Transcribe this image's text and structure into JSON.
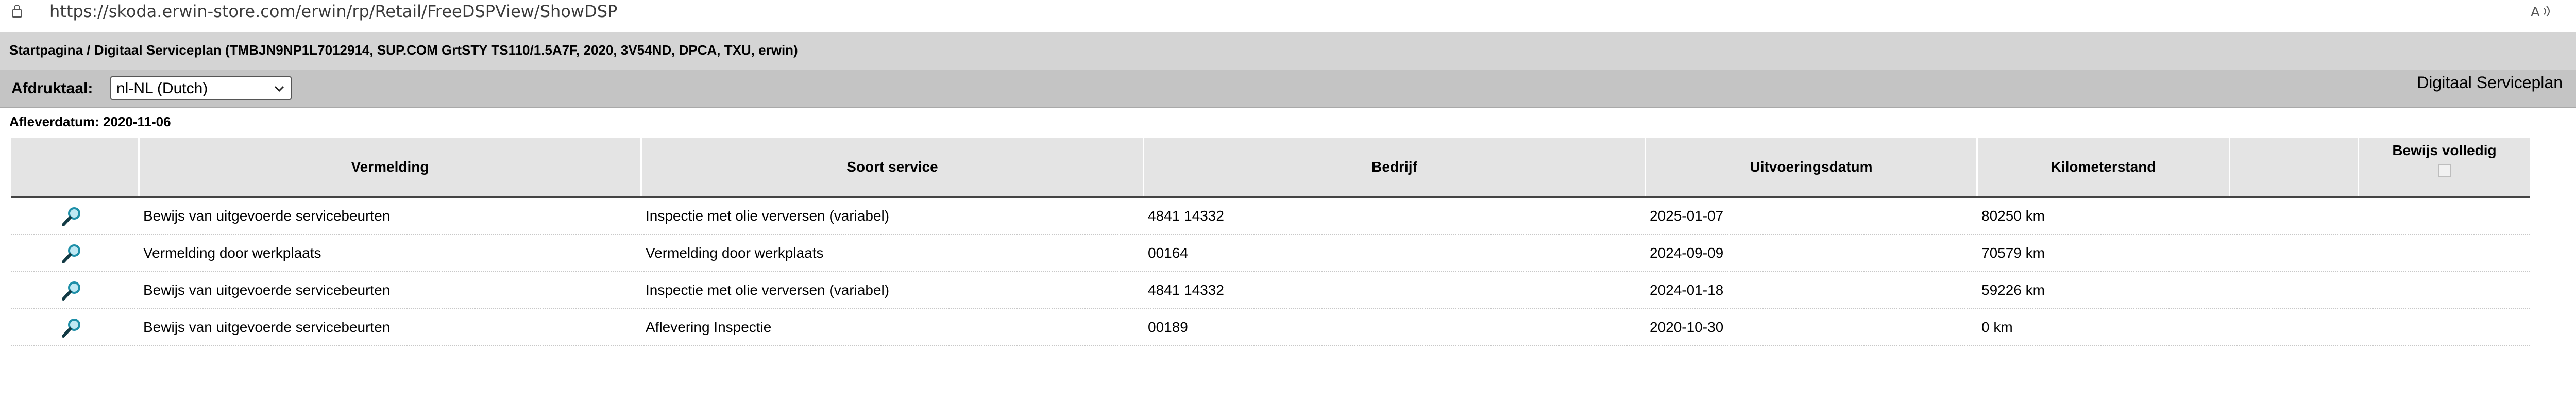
{
  "browser": {
    "url": "https://skoda.erwin-store.com/erwin/rp/Retail/FreeDSPView/ShowDSP",
    "lock_icon": "lock-icon",
    "readaloud_icon": "read-aloud-icon"
  },
  "breadcrumb": {
    "text": "Startpagina / Digitaal Serviceplan (TMBJN9NP1L7012914, SUP.COM GrtSTY TS110/1.5A7F, 2020, 3V54ND, DPCA, TXU, erwin)"
  },
  "toolbar": {
    "language_label": "Afdruktaal:",
    "language_value": "nl-NL (Dutch)",
    "page_heading": "Digitaal Serviceplan"
  },
  "delivery_date": "Afleverdatum: 2020-11-06",
  "table": {
    "headers": {
      "col_icon": "",
      "col_entry": "Vermelding",
      "col_service": "Soort service",
      "col_company": "Bedrijf",
      "col_date": "Uitvoeringsdatum",
      "col_km": "Kilometerstand",
      "col_blank": "",
      "col_proof": "Bewijs volledig"
    },
    "rows": [
      {
        "entry": "Bewijs van uitgevoerde servicebeurten",
        "service": "Inspectie met olie verversen (variabel)",
        "company": "4841 14332",
        "date": "2025-01-07",
        "km": "80250 km"
      },
      {
        "entry": "Vermelding door werkplaats",
        "service": "Vermelding door werkplaats",
        "company": "00164",
        "date": "2024-09-09",
        "km": "70579 km"
      },
      {
        "entry": "Bewijs van uitgevoerde servicebeurten",
        "service": "Inspectie met olie verversen (variabel)",
        "company": "4841 14332",
        "date": "2024-01-18",
        "km": "59226 km"
      },
      {
        "entry": "Bewijs van uitgevoerde servicebeurten",
        "service": "Aflevering Inspectie",
        "company": "00189",
        "date": "2020-10-30",
        "km": "0 km"
      }
    ]
  },
  "colors": {
    "breadcrumb_bg": "#d4d4d4",
    "toolbar_bg": "#c4c4c4",
    "header_bg": "#e4e4e4",
    "magnifier": "#1e8fa8"
  }
}
